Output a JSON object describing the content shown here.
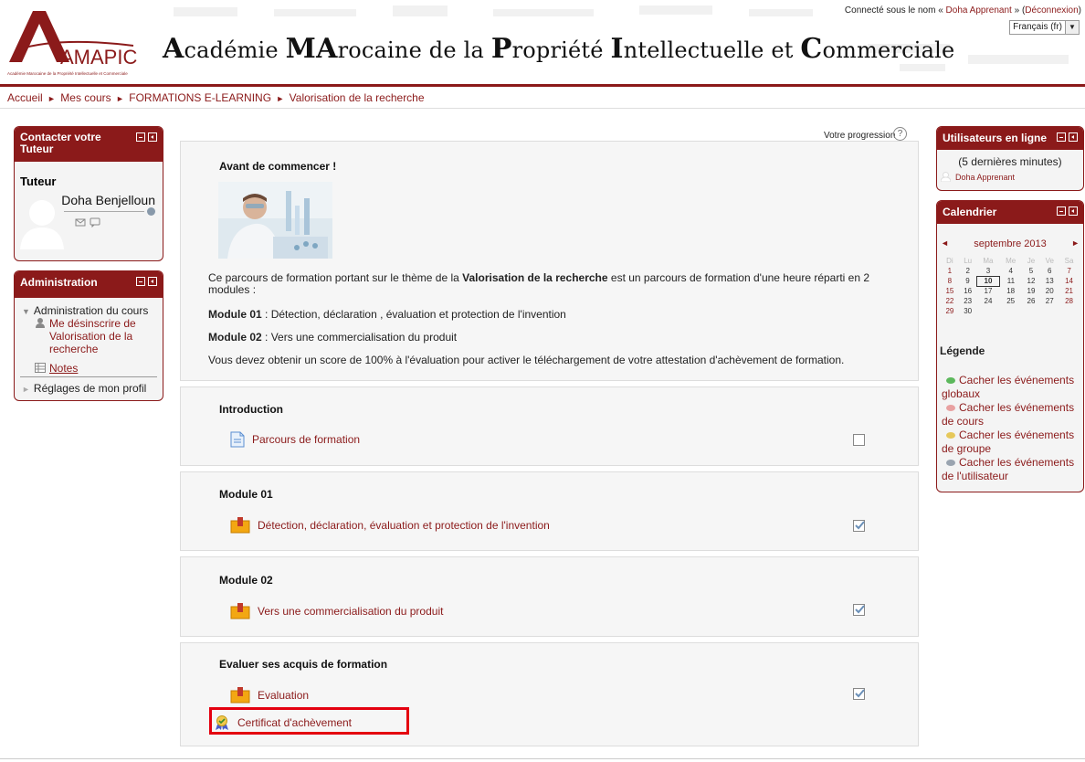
{
  "header": {
    "logo_text": "AMAPIC",
    "logo_subtext": "Académie Marocaine de la Propriété Intellectuelle et Commerciale",
    "site_title_parts": [
      {
        "text": "A",
        "big": true
      },
      {
        "text": "cadémie ",
        "big": false
      },
      {
        "text": "MA",
        "big": true
      },
      {
        "text": "rocaine de la ",
        "big": false
      },
      {
        "text": "P",
        "big": true
      },
      {
        "text": "ropriété ",
        "big": false
      },
      {
        "text": "I",
        "big": true
      },
      {
        "text": "ntellectuelle et ",
        "big": false
      },
      {
        "text": "C",
        "big": true
      },
      {
        "text": "ommerciale",
        "big": false
      }
    ],
    "login_prefix": "Connecté sous le nom « ",
    "login_user": "Doha Apprenant",
    "login_mid": " » (",
    "logout_label": "Déconnexion",
    "login_suffix": ")",
    "language": "Français (fr)"
  },
  "breadcrumb": [
    "Accueil",
    "Mes cours",
    "FORMATIONS E-LEARNING",
    "Valorisation de la recherche"
  ],
  "tutor_block": {
    "title": "Contacter votre Tuteur",
    "heading": "Tuteur",
    "name": "Doha Benjelloun"
  },
  "admin_block": {
    "title": "Administration",
    "course_admin": "Administration du cours",
    "unenrol": "Me désinscrire de Valorisation de la recherche",
    "unenrol_lines": [
      "Me désinscrire de",
      "Valorisation de la",
      "recherche"
    ],
    "notes": "Notes",
    "profile_settings": "Réglages de mon profil"
  },
  "main": {
    "progress_label": "Votre progression",
    "intro": {
      "title": "Avant de commencer !",
      "para1_before": "Ce parcours de formation portant sur le thème de la ",
      "para1_bold": "Valorisation de la recherche",
      "para1_after": " est un parcours de formation d'une heure réparti en 2",
      "para1_line2": "modules :",
      "module1_label": "Module 01",
      "module1_text": " : Détection, déclaration , évaluation et protection de l'invention",
      "module2_label": "Module 02",
      "module2_text": " : Vers une commercialisation du produit",
      "score_text": "Vous devez obtenir un score de 100% à l'évaluation pour activer le téléchargement de votre attestation d'achèvement de formation."
    },
    "sections": [
      {
        "title": "Introduction",
        "activities": [
          {
            "label": "Parcours de formation",
            "icon": "page-icon",
            "completed": false
          }
        ]
      },
      {
        "title": "Module 01",
        "activities": [
          {
            "label": "Détection, déclaration, évaluation et protection de l'invention",
            "icon": "scorm-package-icon",
            "completed": true
          }
        ]
      },
      {
        "title": "Module 02",
        "activities": [
          {
            "label": "Vers une commercialisation du produit",
            "icon": "scorm-package-icon",
            "completed": true
          }
        ]
      },
      {
        "title": "Evaluer ses acquis de formation",
        "activities": [
          {
            "label": "Evaluation",
            "icon": "scorm-package-icon",
            "completed": true
          },
          {
            "label": "Certificat d'achèvement",
            "icon": "certificate-icon",
            "completed": null
          }
        ]
      }
    ]
  },
  "online_block": {
    "title": "Utilisateurs en ligne",
    "subtitle": "(5 dernières minutes)",
    "users": [
      "Doha Apprenant"
    ]
  },
  "calendar_block": {
    "title": "Calendrier",
    "month": "septembre 2013",
    "prev": "◄",
    "next": "►",
    "weekdays": [
      "Di",
      "Lu",
      "Ma",
      "Me",
      "Je",
      "Ve",
      "Sa"
    ],
    "weeks": [
      [
        "1",
        "2",
        "3",
        "4",
        "5",
        "6",
        "7"
      ],
      [
        "8",
        "9",
        "10",
        "11",
        "12",
        "13",
        "14"
      ],
      [
        "15",
        "16",
        "17",
        "18",
        "19",
        "20",
        "21"
      ],
      [
        "22",
        "23",
        "24",
        "25",
        "26",
        "27",
        "28"
      ],
      [
        "29",
        "30",
        "",
        "",
        "",
        "",
        ""
      ]
    ],
    "today": "10",
    "legend_title": "Légende",
    "legend": [
      {
        "lines": [
          "Cacher les événements",
          "globaux"
        ],
        "color": "#5cb85c"
      },
      {
        "lines": [
          "Cacher les événements",
          "de cours"
        ],
        "color": "#e8a0a0"
      },
      {
        "lines": [
          "Cacher les événements",
          "de groupe"
        ],
        "color": "#e6c85a"
      },
      {
        "lines": [
          "Cacher les événements",
          "de l'utilisateur"
        ],
        "color": "#9aa4b0"
      }
    ]
  },
  "colors": {
    "brand": "#8b1a1a",
    "highlight": "#e4000f"
  }
}
